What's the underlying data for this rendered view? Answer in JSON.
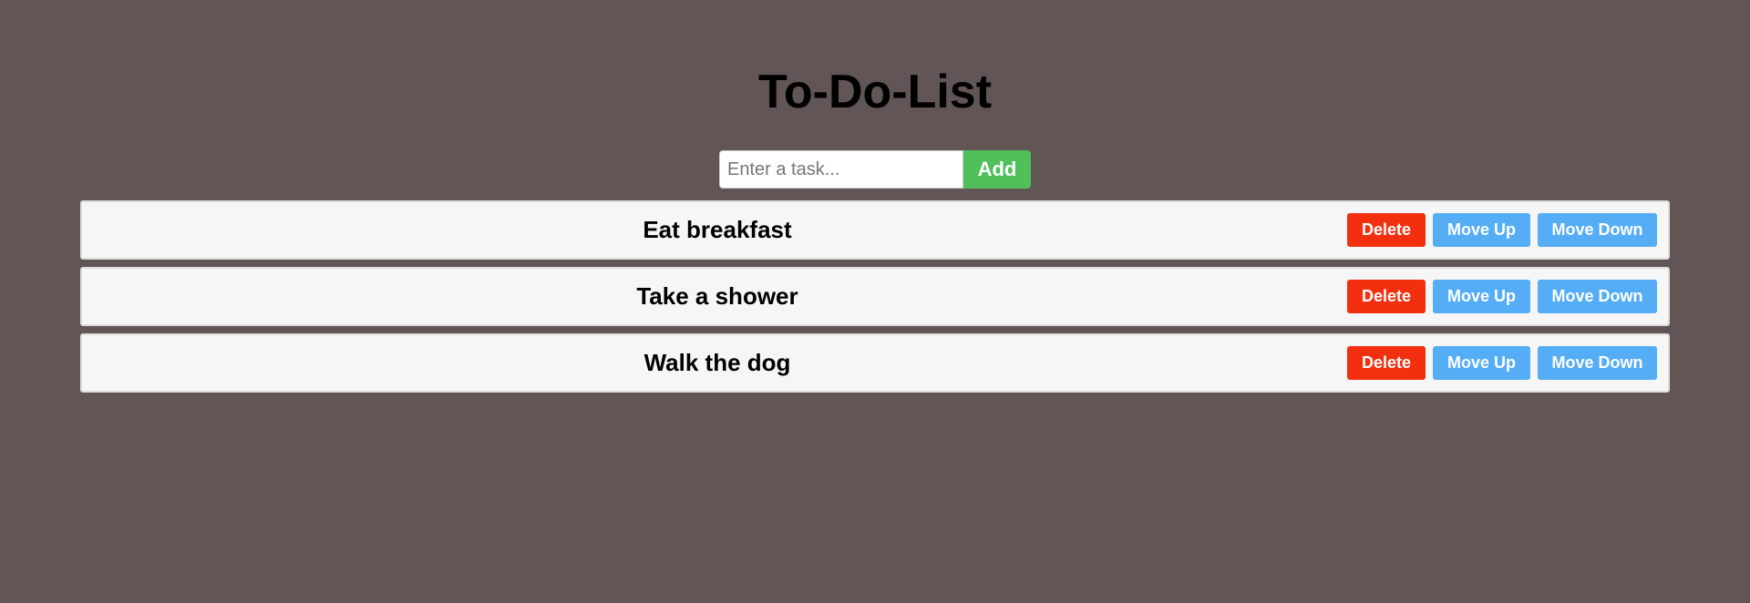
{
  "title": "To-Do-List",
  "new_task": {
    "value": "",
    "placeholder": "Enter a task...",
    "add_label": "Add"
  },
  "tasks": [
    {
      "text": "Eat breakfast",
      "delete_label": "Delete",
      "up_label": "Move Up",
      "down_label": "Move Down"
    },
    {
      "text": "Take a shower",
      "delete_label": "Delete",
      "up_label": "Move Up",
      "down_label": "Move Down"
    },
    {
      "text": "Walk the dog",
      "delete_label": "Delete",
      "up_label": "Move Up",
      "down_label": "Move Down"
    }
  ],
  "colors": {
    "background": "#615555",
    "add": "#4fc05a",
    "delete": "#f2300f",
    "move": "#55adf5",
    "item_background": "#f6f6f6"
  }
}
